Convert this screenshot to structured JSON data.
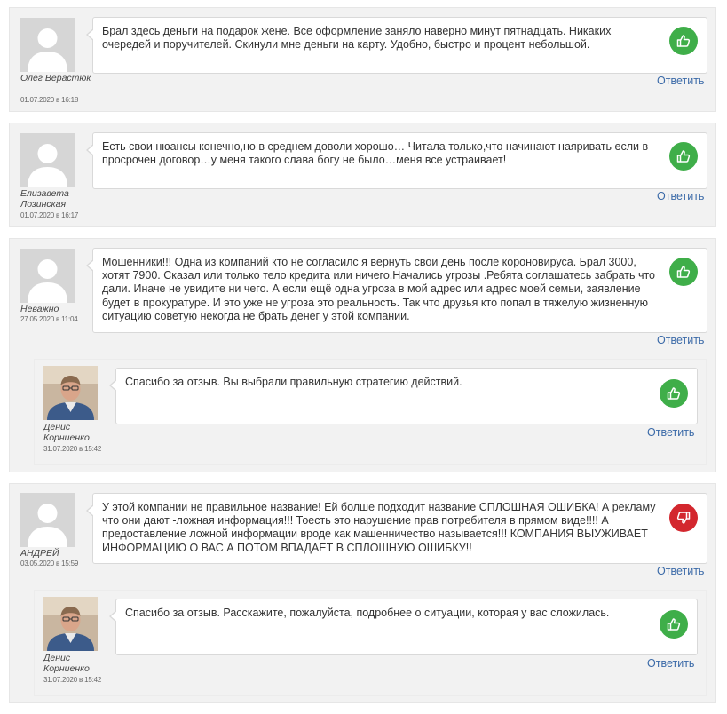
{
  "comments": [
    {
      "author": "Олег Верастюк",
      "date": "01.07.2020 в 16:18",
      "text": "Брал здесь деньги на подарок жене. Все оформление заняло наверно минут пятнадцать. Никаких очередей и поручителей. Скинули мне деньги на карту. Удобно, быстро и процент небольшой.",
      "vote": "thumbs-up-icon",
      "reply_label": "Ответить"
    },
    {
      "author": "Елизавета Лозинская",
      "date": "01.07.2020 в 16:17",
      "text": "Есть свои нюансы конечно,но в среднем доволи хорошо… Читала только,что начинают наяривать если в просрочен договор…у меня такого слава богу не было…меня все устраивает!",
      "vote": "thumbs-up-icon",
      "reply_label": "Ответить"
    },
    {
      "author": "Неважно",
      "date": "27.05.2020 в 11:04",
      "text": "Мошенники!!! Одна из компаний кто не согласилс я вернуть свои день после короновируса. Брал 3000, хотят 7900. Сказал или только тело кредита или ничего.Начались угрозы .Ребята соглашатесь забрать что дали. Иначе не увидите ни чего. А если ещё одна угроза в мой адрес или адрес моей семьи, заявление будет в прокуратуре. И это уже не угроза это реальность. Так что друзья кто попал в тяжелую жизненную ситуацию советую некогда не брать денег у этой компании.",
      "vote": "thumbs-up-icon",
      "reply_label": "Ответить",
      "reply": {
        "author": "Денис Корниенко",
        "date": "31.07.2020 в 15:42",
        "text": "Спасибо за отзыв. Вы выбрали правильную стратегию действий.",
        "vote": "thumbs-up-icon",
        "reply_label": "Ответить"
      }
    },
    {
      "author": "АНДРЕЙ",
      "date": "03.05.2020 в 15:59",
      "text": "У этой компании не правильное название! Ей болше подходит название СПЛОШНАЯ ОШИБКА! А рекламу что они дают -ложная информация!!! Тоесть это нарушение прав потребителя в прямом виде!!!! А предоставление ложной информации вроде как машенничество называется!!! КОМПАНИЯ ВЫУЖИВАЕТ ИНФОРМАЦИЮ О ВАС А ПОТОМ ВПАДАЕТ В СПЛОШНУЮ ОШИБКУ!!",
      "vote": "thumbs-down-icon",
      "reply_label": "Ответить",
      "reply": {
        "author": "Денис Корниенко",
        "date": "31.07.2020 в 15:42",
        "text": "Спасибо за отзыв. Расскажите, пожалуйста, подробнее о ситуации, которая у вас сложилась.",
        "vote": "thumbs-up-icon",
        "reply_label": "Ответить"
      }
    }
  ],
  "colors": {
    "vote_up": "#3fae49",
    "vote_down": "#d3272e",
    "link": "#3b6aa8"
  }
}
